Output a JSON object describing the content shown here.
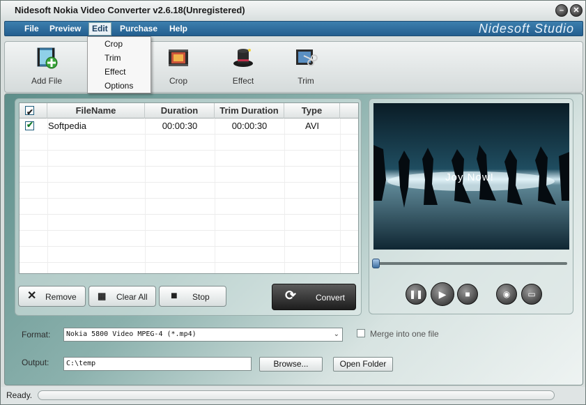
{
  "window": {
    "title": "Nidesoft Nokia Video Converter v2.6.18(Unregistered)"
  },
  "menubar": {
    "items": [
      "File",
      "Preview",
      "Edit",
      "Purchase",
      "Help"
    ],
    "brand": "Nidesoft Studio"
  },
  "edit_menu": {
    "items": [
      "Crop",
      "Trim",
      "Effect",
      "Options"
    ]
  },
  "toolbar": {
    "add_file": "Add File",
    "crop": "Crop",
    "effect": "Effect",
    "trim": "Trim"
  },
  "file_list": {
    "columns": [
      "FileName",
      "Duration",
      "Trim Duration",
      "Type"
    ],
    "rows": [
      {
        "checked": true,
        "filename": "Softpedia",
        "duration": "00:00:30",
        "trim_duration": "00:00:30",
        "type": "AVI"
      }
    ]
  },
  "list_buttons": {
    "remove": "Remove",
    "clear_all": "Clear All",
    "stop": "Stop",
    "convert": "Convert"
  },
  "preview": {
    "overlay_text": "Joy Now!",
    "seek_position": 0
  },
  "settings": {
    "format_label": "Format:",
    "format_value": "Nokia 5800 Video MPEG-4 (*.mp4)",
    "merge_label": "Merge into one file",
    "output_label": "Output:",
    "output_value": "C:\\temp",
    "browse": "Browse...",
    "open_folder": "Open Folder"
  },
  "status": {
    "text": "Ready.",
    "progress": 0
  },
  "colors": {
    "menubar": "#2f6f9f",
    "convert_button": "#2a2a2a",
    "accent_green": "#3aa53a"
  }
}
